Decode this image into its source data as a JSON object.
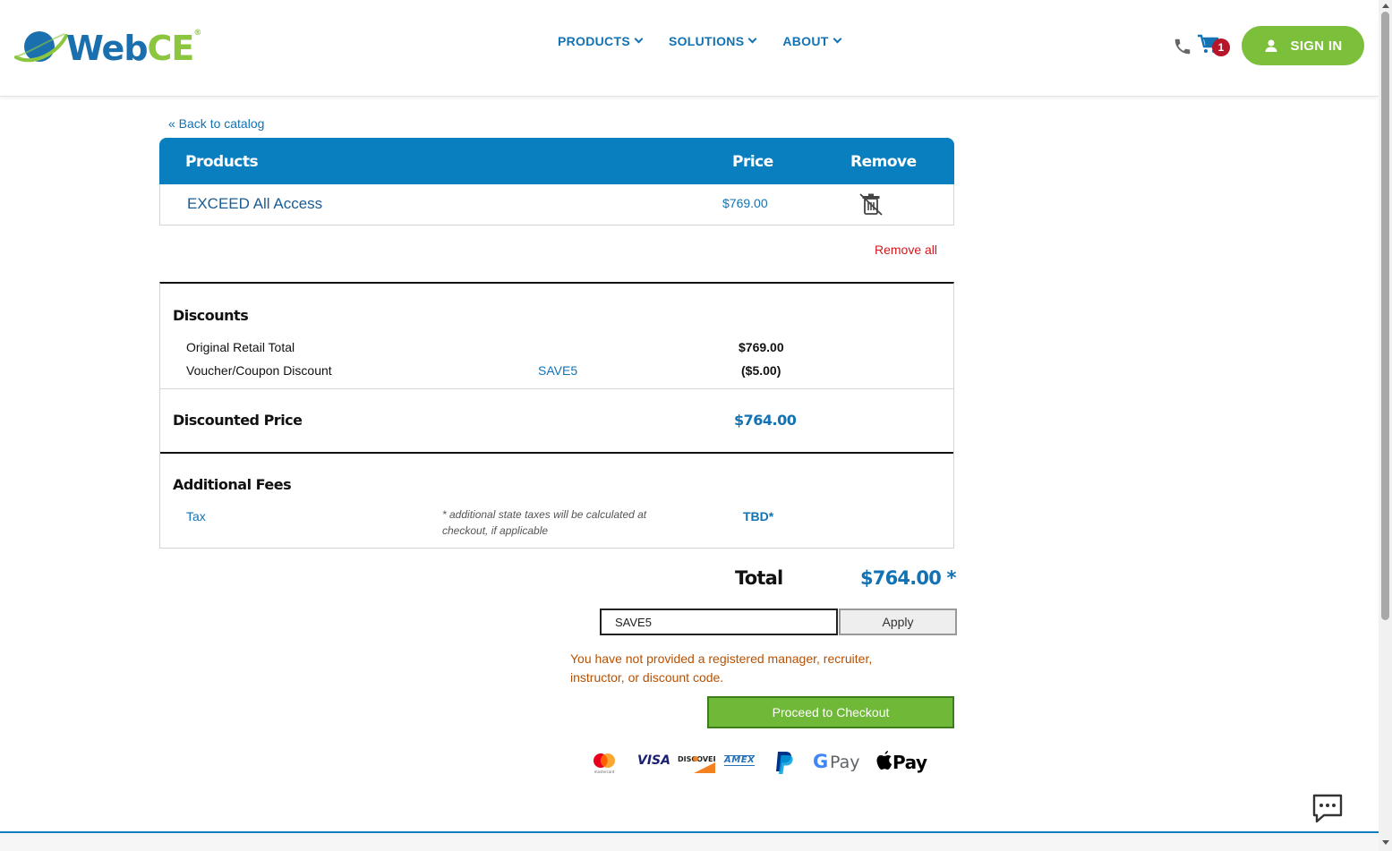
{
  "header": {
    "brand": {
      "part1": "Web",
      "part2": "CE",
      "reg": "®"
    },
    "nav": [
      {
        "label": "PRODUCTS"
      },
      {
        "label": "SOLUTIONS"
      },
      {
        "label": "ABOUT"
      }
    ],
    "cart_count": "1",
    "signin_label": "SIGN IN"
  },
  "back_link": "« Back to catalog",
  "products_table": {
    "headers": {
      "product": "Products",
      "price": "Price",
      "remove": "Remove"
    },
    "rows": [
      {
        "name": "EXCEED All Access",
        "price": "$769.00"
      }
    ],
    "remove_all": "Remove all"
  },
  "discounts": {
    "title": "Discounts",
    "original_label": "Original Retail Total",
    "original_value": "$769.00",
    "voucher_label": "Voucher/Coupon Discount",
    "voucher_code": "SAVE5",
    "voucher_value": "($5.00)"
  },
  "discounted_price": {
    "label": "Discounted Price",
    "value": "$764.00"
  },
  "additional_fees": {
    "title": "Additional Fees",
    "tax_label": "Tax",
    "tax_note": "* additional state taxes will be calculated at checkout, if applicable",
    "tax_value": "TBD*"
  },
  "total": {
    "label": "Total",
    "value": "$764.00 *"
  },
  "coupon": {
    "value": "SAVE5",
    "apply_label": "Apply"
  },
  "warning": "You have not provided a registered manager, recruiter, instructor, or discount code.",
  "checkout_label": "Proceed to Checkout",
  "payment_methods": {
    "mastercard": "mastercard",
    "visa": "VISA",
    "discover": "DISCOVER",
    "amex": "AMEX",
    "gpay_g": "G",
    "gpay_text": "Pay",
    "applepay_text": "Pay"
  },
  "colors": {
    "brand_blue": "#0a7fbf",
    "brand_green": "#7cbf3b",
    "link_blue": "#1272b3",
    "alert_red": "#d0181f"
  }
}
